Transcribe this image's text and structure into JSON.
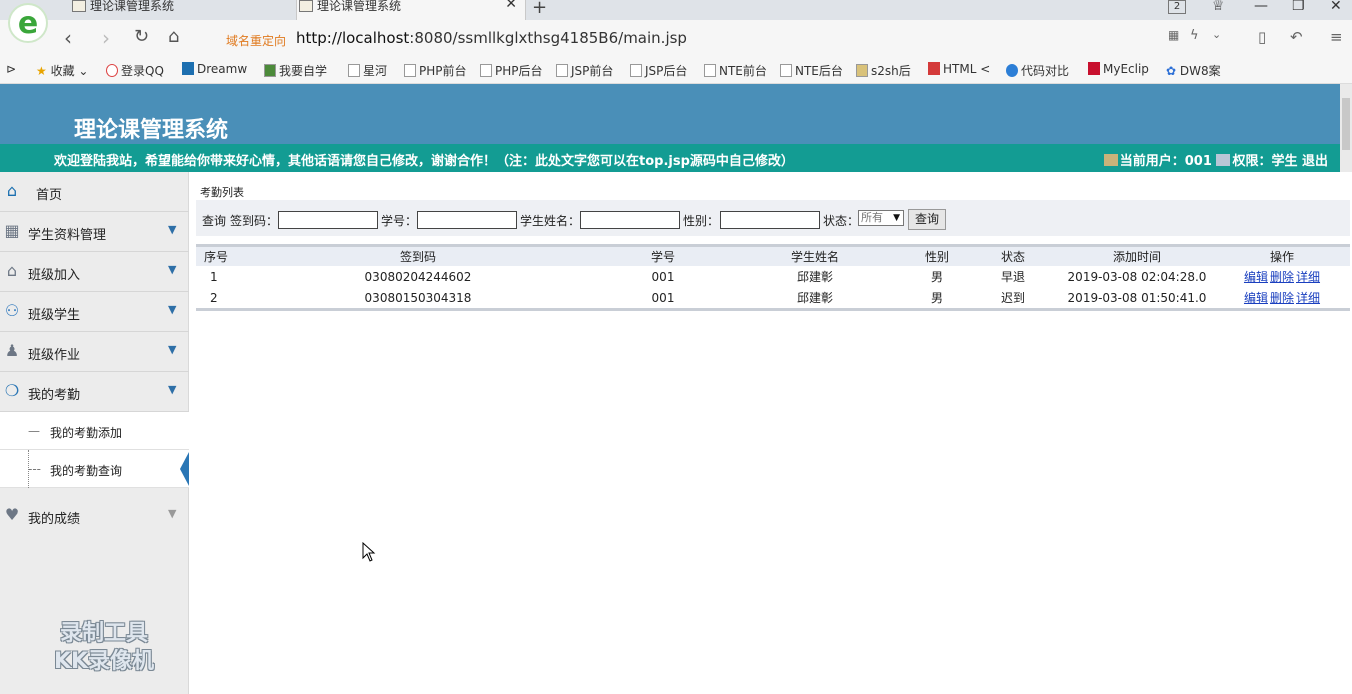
{
  "browser": {
    "tabs": [
      {
        "title": "理论课管理系统",
        "active": false
      },
      {
        "title": "理论课管理系统",
        "active": true
      }
    ],
    "tab_count_badge": "2",
    "redirect_label": "域名重定向",
    "url_host": "http://localhost",
    "url_rest": ":8080/ssmllkglxthsg4185B6/main.jsp",
    "bookmarks": [
      "收藏",
      "登录QQ",
      "Dreamw",
      "我要自学",
      "星河",
      "PHP前台",
      "PHP后台",
      "JSP前台",
      "JSP后台",
      "NTE前台",
      "NTE后台",
      "s2sh后",
      "HTML <",
      "代码对比",
      "MyEclip",
      "DW8案"
    ]
  },
  "header": {
    "site_title": "理论课管理系统",
    "welcome": "欢迎登陆我站，希望能给你带来好心情，其他话语请您自己修改，谢谢合作！（注：此处文字您可以在top.jsp源码中自己修改）",
    "current_user_label": "当前用户：001",
    "role_label": "权限：学生",
    "logout": "退出"
  },
  "sidebar": {
    "items": [
      {
        "label": "首页",
        "icon": "home-icon"
      },
      {
        "label": "学生资料管理",
        "icon": "grid-icon"
      },
      {
        "label": "班级加入",
        "icon": "house-icon"
      },
      {
        "label": "班级学生",
        "icon": "users-icon"
      },
      {
        "label": "班级作业",
        "icon": "user-icon"
      },
      {
        "label": "我的考勤",
        "icon": "chat-icon"
      },
      {
        "label": "我的成绩",
        "icon": "heart-icon"
      }
    ],
    "subitems": [
      {
        "label": "我的考勤添加"
      },
      {
        "label": "我的考勤查询",
        "active": true
      }
    ],
    "watermark_line1": "录制工具",
    "watermark_line2": "KK录像机"
  },
  "content": {
    "breadcrumb": "考勤列表",
    "search": {
      "query_label": "查询",
      "code_label": "签到码：",
      "sno_label": "学号：",
      "name_label": "学生姓名：",
      "sex_label": "性别：",
      "status_label": "状态：",
      "status_value": "所有",
      "button": "查询"
    },
    "table": {
      "headers": [
        "序号",
        "签到码",
        "学号",
        "学生姓名",
        "性别",
        "状态",
        "添加时间",
        "操作"
      ],
      "rows": [
        {
          "seq": "1",
          "code": "03080204244602",
          "sno": "001",
          "name": "邱建彰",
          "sex": "男",
          "status": "早退",
          "time": "2019-03-08 02:04:28.0"
        },
        {
          "seq": "2",
          "code": "03080150304318",
          "sno": "001",
          "name": "邱建彰",
          "sex": "男",
          "status": "迟到",
          "time": "2019-03-08 01:50:41.0"
        }
      ],
      "actions": {
        "edit": "编辑",
        "delete": "删除",
        "detail": "详细"
      }
    }
  },
  "colors": {
    "banner": "#4a8fb8",
    "welcome_bar": "#139c93",
    "link": "#1a3fbf",
    "accent": "#2a76b5"
  }
}
